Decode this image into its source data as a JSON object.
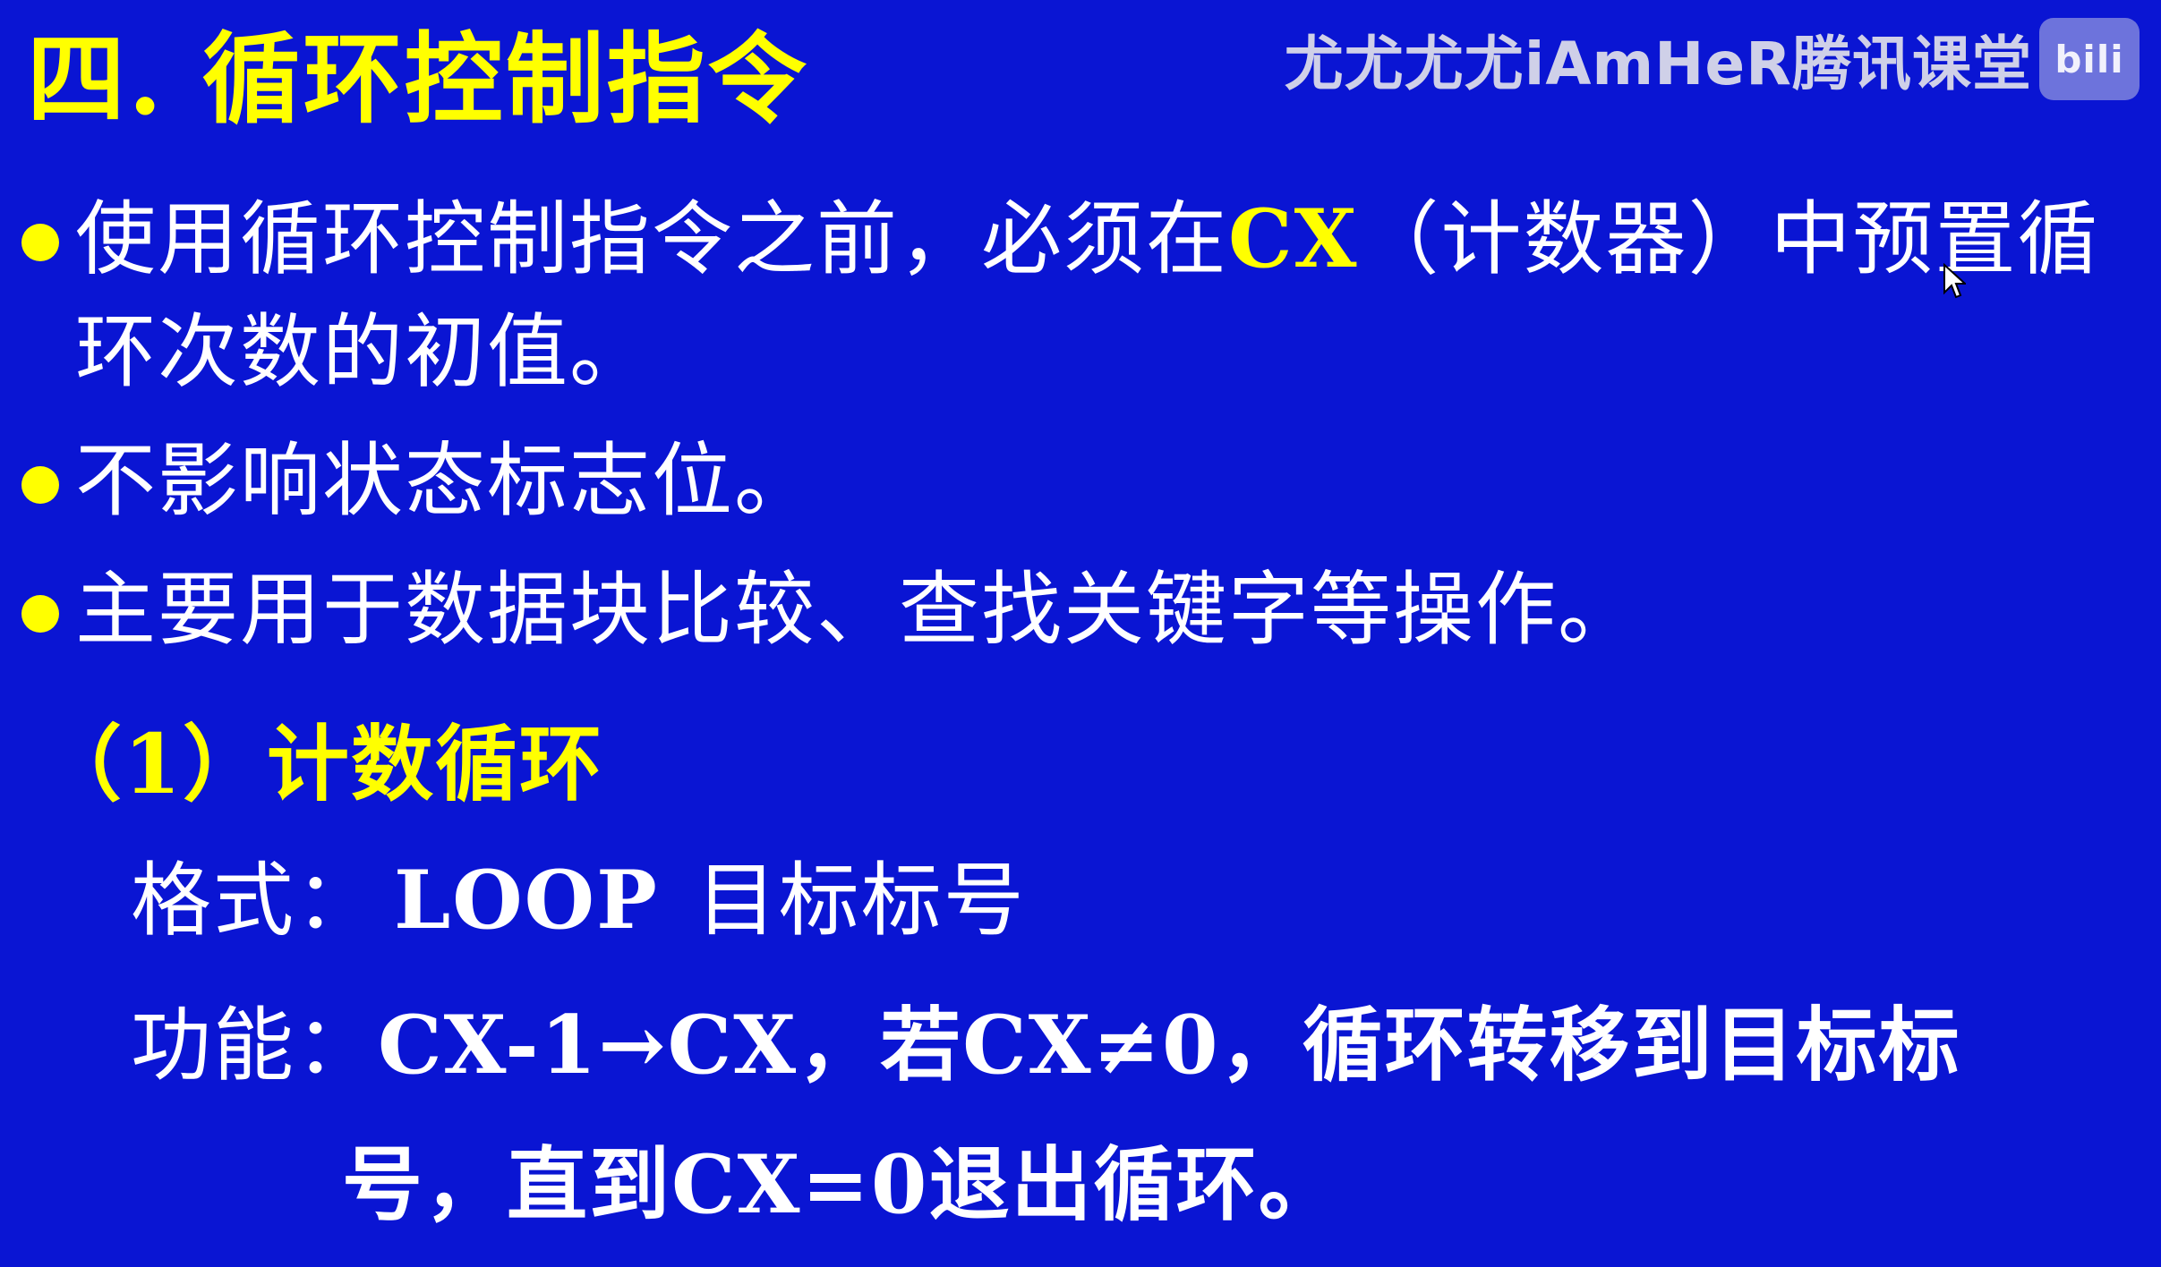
{
  "watermark": {
    "text": "尤尤尤尤iAmHeR腾讯课堂",
    "logo": "bili"
  },
  "title": "四. 循环控制指令",
  "bullets": [
    {
      "prefix": "使用循环控制指令之前，必须在",
      "cx": "CX",
      "suffix": "（计数器）中预置循环次数的初值。"
    },
    {
      "text": "不影响状态标志位。"
    },
    {
      "text": "主要用于数据块比较、查找关键字等操作。"
    }
  ],
  "section": "（1）计数循环",
  "format": {
    "label": "格式：",
    "instruction": "LOOP",
    "operand": "目标标号"
  },
  "function": {
    "label": "功能：",
    "line1": "CX-1→CX，若CX≠0，循环转移到目标标",
    "line2": "号，直到CX=0退出循环。"
  }
}
